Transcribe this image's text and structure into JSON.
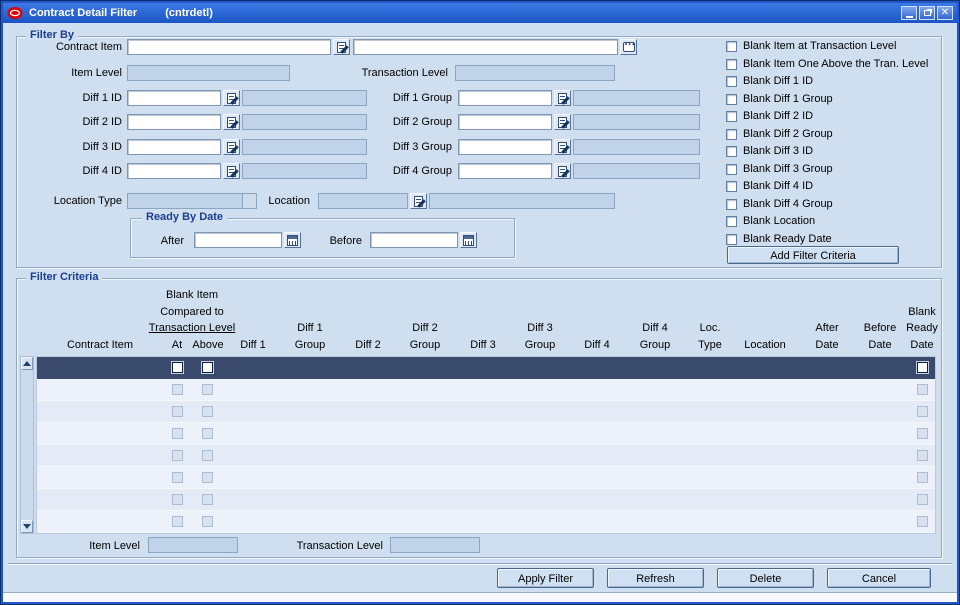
{
  "window": {
    "title": "Contract Detail Filter",
    "code": "(cntrdetl)"
  },
  "colors": {
    "titlebar": "#1b55c6",
    "canvas": "#d0dfef",
    "selected_row": "#394a6c",
    "legend_text": "#1a3e91"
  },
  "filter_by": {
    "legend": "Filter By",
    "contract_item_label": "Contract Item",
    "contract_item_value": "",
    "contract_item_desc": "",
    "item_level_label": "Item Level",
    "item_level_value": "",
    "transaction_level_label": "Transaction Level",
    "transaction_level_value": "",
    "diffs": [
      {
        "id_label": "Diff 1 ID",
        "id_value": "",
        "id_desc": "",
        "group_label": "Diff 1 Group",
        "group_value": "",
        "group_desc": ""
      },
      {
        "id_label": "Diff 2 ID",
        "id_value": "",
        "id_desc": "",
        "group_label": "Diff 2 Group",
        "group_value": "",
        "group_desc": ""
      },
      {
        "id_label": "Diff 3 ID",
        "id_value": "",
        "id_desc": "",
        "group_label": "Diff 3 Group",
        "group_value": "",
        "group_desc": ""
      },
      {
        "id_label": "Diff 4 ID",
        "id_value": "",
        "id_desc": "",
        "group_label": "Diff 4 Group",
        "group_value": "",
        "group_desc": ""
      }
    ],
    "location_type_label": "Location Type",
    "location_type_value": "",
    "location_label": "Location",
    "location_value": "",
    "location_desc": "",
    "ready_by_date": {
      "legend": "Ready By Date",
      "after_label": "After",
      "after_value": "",
      "before_label": "Before",
      "before_value": ""
    },
    "blank_checkboxes": [
      "Blank Item at Transaction Level",
      "Blank Item One Above the Tran. Level",
      "Blank Diff 1 ID",
      "Blank Diff 1 Group",
      "Blank Diff 2 ID",
      "Blank Diff 2 Group",
      "Blank Diff 3 ID",
      "Blank Diff 3 Group",
      "Blank Diff 4 ID",
      "Blank Diff 4 Group",
      "Blank Location",
      "Blank Ready Date"
    ],
    "add_button_label": "Add Filter Criteria"
  },
  "filter_criteria": {
    "legend": "Filter Criteria",
    "header": {
      "blank_item_line1": "Blank Item",
      "blank_item_line2": "Compared to",
      "blank_item_line3": "Transaction Level",
      "contract_item": "Contract Item",
      "at": "At",
      "above": "Above",
      "diff1": "Diff 1",
      "diff2": "Diff 2",
      "diff3": "Diff 3",
      "diff4": "Diff 4",
      "group": "Group",
      "loc_line1": "Loc.",
      "loc_line2": "Type",
      "location": "Location",
      "after": "After",
      "before": "Before",
      "date": "Date",
      "blank": "Blank",
      "ready": "Ready"
    },
    "grid": {
      "visible_rows": 8,
      "selected_row": 1
    },
    "footer": {
      "item_level_label": "Item Level",
      "item_level_value": "",
      "transaction_level_label": "Transaction Level",
      "transaction_level_value": ""
    }
  },
  "buttons": {
    "apply": "Apply Filter",
    "refresh": "Refresh",
    "delete": "Delete",
    "cancel": "Cancel"
  }
}
